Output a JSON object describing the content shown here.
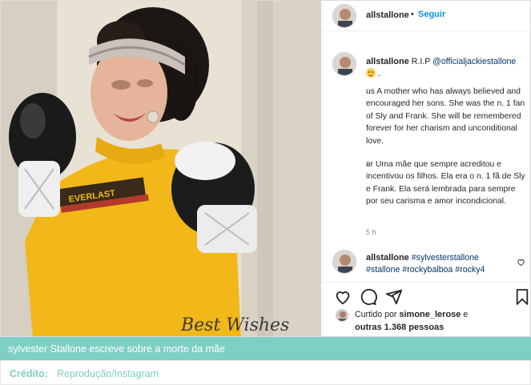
{
  "post": {
    "username": "allstallone",
    "dot": "•",
    "follow_label": "Seguir",
    "caption": {
      "prefix": "R.I.P",
      "mention": "@officialjackiestallone",
      "suffix": ".",
      "para_en": "us A mother who has always believed and encouraged her sons. She was the n. 1 fan of Sly and Frank. She will be remembered forever for her charism and unconditional love.",
      "para_pt": "вr Uma mãe que sempre acreditou e incentivou os filhos. Ela era o n. 1 fã de Sly e Frank. Ela será lembrada para sempre por seu carisma e amor incondicional."
    },
    "time": "5 h",
    "comment": {
      "username": "allstallone",
      "tags": "#sylvesterstallone #stallone #rockybalboa #rocky4"
    },
    "likes": {
      "prefix": "Curtido por",
      "user": "simone_lerose",
      "suffix": "e",
      "others": "outras 1.368 pessoas"
    },
    "photo_signature": "Best Wishes",
    "photo_shirt_logo": "EVERLAST"
  },
  "article": {
    "caption": "sylvester Stallone escreve sobre a morte da mãe",
    "credit_label": "Crédito:",
    "credit_source": "Reprodução/Instagram"
  },
  "colors": {
    "accent_teal": "#7fcfc5",
    "follow_blue": "#0095f6",
    "link_navy": "#00376b"
  },
  "icons": [
    "heart-icon",
    "comment-icon",
    "share-icon",
    "bookmark-icon",
    "small-heart-icon"
  ]
}
